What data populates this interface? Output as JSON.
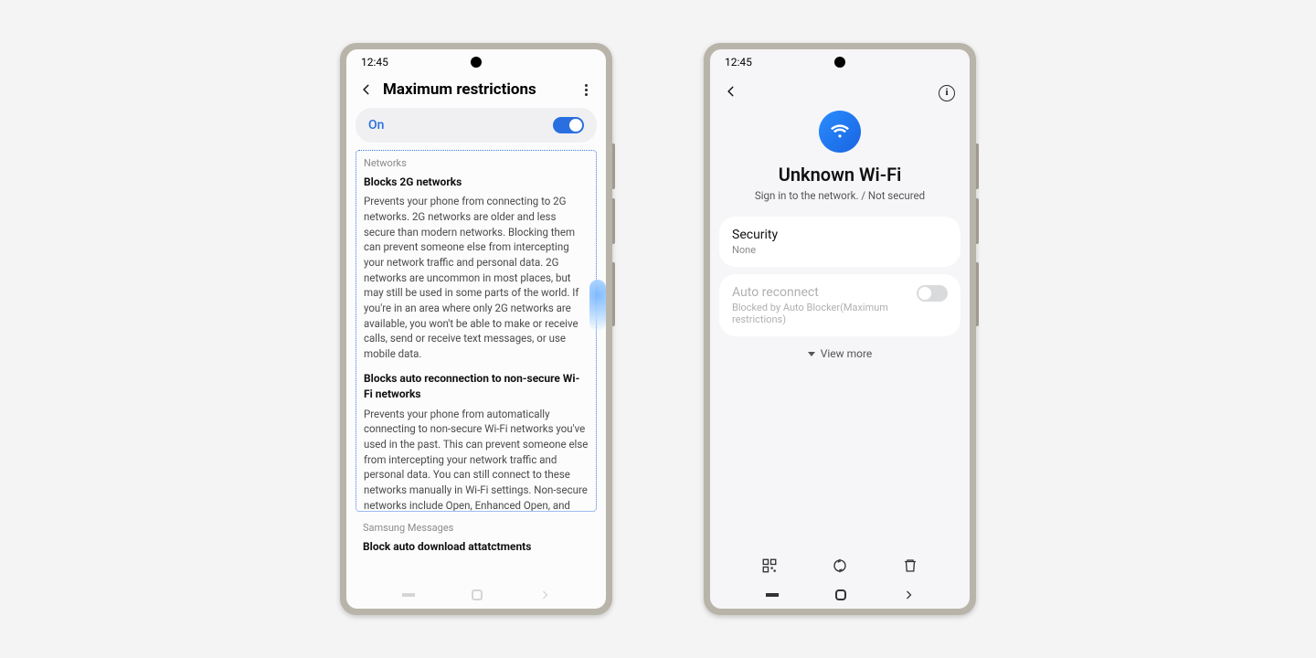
{
  "left": {
    "time": "12:45",
    "title": "Maximum restrictions",
    "on_label": "On",
    "toggle_on": true,
    "highlight_section_label": "Networks",
    "items": [
      {
        "title": "Blocks 2G networks",
        "body": "Prevents your phone from connecting to 2G networks. 2G networks are older and less secure than modern networks. Blocking them can prevent someone else from intercepting your network traffic and personal data. 2G networks are uncommon in most places, but may still be used in some parts of the world. If you're in an area where only 2G networks are available, you won't be able to make or receive calls, send or receive text messages, or use mobile data."
      },
      {
        "title": "Blocks auto reconnection to non-secure Wi-Fi networks",
        "body": "Prevents your phone from automatically connecting to non-secure Wi-Fi networks you've used in the past. This can prevent someone else from intercepting your network traffic and personal data. You can still connect to these networks manually in Wi-Fi settings. Non-secure networks include Open, Enhanced Open, and WEP networks."
      }
    ],
    "next_section_label": "Samsung Messages",
    "next_item_title": "Block auto download attatctments"
  },
  "right": {
    "time": "12:45",
    "nav_back": "Back",
    "nav_info": "Information",
    "wifi_name": "Unknown Wi-Fi",
    "wifi_status": "Sign in to the network. / Not secured",
    "security_card": {
      "title": "Security",
      "value": "None"
    },
    "auto_card": {
      "title": "Auto reconnect",
      "sub": "Blocked by Auto Blocker(Maximum restrictions)",
      "toggle_on": false
    },
    "view_more": "View more",
    "bottom_actions": [
      "qr-code-icon",
      "sync-icon",
      "trash-icon"
    ]
  }
}
